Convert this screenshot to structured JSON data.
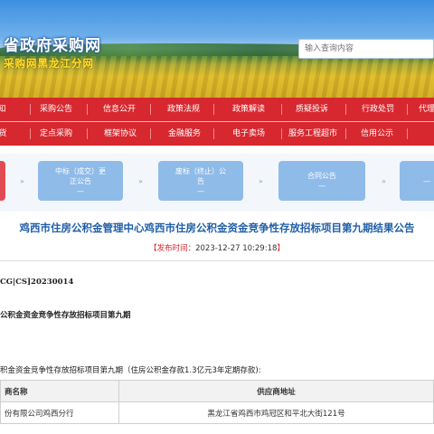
{
  "header": {
    "logo_line1": "省政府采购网",
    "logo_line2": "采购网黑龙江分网",
    "search_placeholder": "输入查询内容"
  },
  "nav_row1": [
    "知",
    "采购公告",
    "信息公开",
    "政策法规",
    "政策解读",
    "质疑投诉",
    "行政处罚",
    "代理"
  ],
  "nav_row2": [
    "货",
    "定点采购",
    "框架协议",
    "金融服务",
    "电子卖场",
    "服务工程超市",
    "信用公示"
  ],
  "steps": [
    {
      "line1": "中标（成交）更",
      "line2": "正公告",
      "dash": "—"
    },
    {
      "line1": "废标（终止）公",
      "line2": "告",
      "dash": "—"
    },
    {
      "line1": "合同公告",
      "line2": "",
      "dash": "—"
    }
  ],
  "notice": {
    "title": "鸡西市住房公积金管理中心鸡西市住房公积金资金竞争性存放招标项目第九期结果公告",
    "publish_label": "【发布时间：",
    "publish_time": "2023-12-27 10:29:18",
    "publish_close": "】",
    "line_code": "CG|CS]20230014",
    "line_project": "公积金资金竞争性存放招标项目第九期",
    "line_desc": "积金资金竞争性存放招标项目第九期（住房公积金存款1.3亿元3年定期存款):"
  },
  "table": {
    "headers": [
      "商名称",
      "供应商地址"
    ],
    "rows": [
      [
        "份有限公司鸡西分行",
        "黑龙江省鸡西市鸡冠区和平北大街121号"
      ]
    ]
  }
}
